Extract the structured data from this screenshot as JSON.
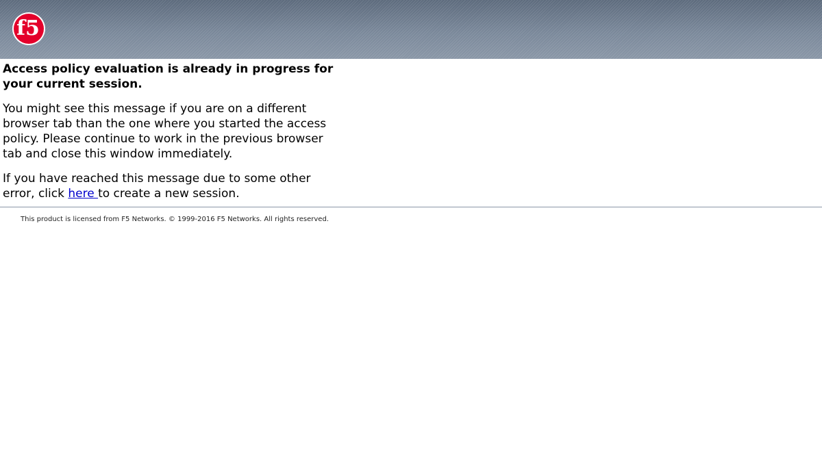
{
  "header": {
    "logo": {
      "text": "f5",
      "icon": "f5-logo-icon",
      "color": "#e4002b"
    },
    "banner_color": "#6c7a8b"
  },
  "message": {
    "title": "Access policy evaluation is already in progress for your current session.",
    "paragraph1": "You might see this message if you are on a different browser tab than the one where you started the access policy. Please continue to work in the previous browser tab and close this window immediately.",
    "paragraph2_before": "If you have reached this message due to some other error, click ",
    "link_text": "here ",
    "paragraph2_after": "to create a new session."
  },
  "footer": {
    "text": "This product is licensed from F5 Networks. © 1999-2016 F5 Networks. All rights reserved."
  }
}
